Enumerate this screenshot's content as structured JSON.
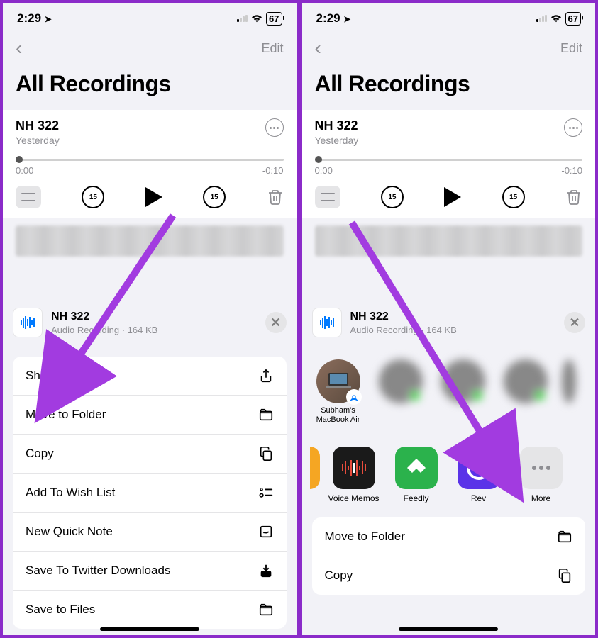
{
  "statusbar": {
    "time": "2:29",
    "battery": "67"
  },
  "nav": {
    "edit": "Edit"
  },
  "page": {
    "title": "All Recordings"
  },
  "recording": {
    "name": "NH 322",
    "date": "Yesterday",
    "start": "0:00",
    "end": "-0:10",
    "skip": "15"
  },
  "sheet": {
    "file_name": "NH 322",
    "file_meta": "Audio Recording · 164 KB"
  },
  "menu_left": {
    "share": "Share",
    "move": "Move to Folder",
    "copy": "Copy",
    "wishlist": "Add To Wish List",
    "note": "New Quick Note",
    "twitter": "Save To Twitter Downloads",
    "files": "Save to Files"
  },
  "airdrop": {
    "macbook": "Subham's MacBook Air"
  },
  "apps": {
    "voice": "Voice Memos",
    "feedly": "Feedly",
    "rev": "Rev",
    "more": "More"
  },
  "menu_right": {
    "move": "Move to Folder",
    "copy": "Copy"
  }
}
